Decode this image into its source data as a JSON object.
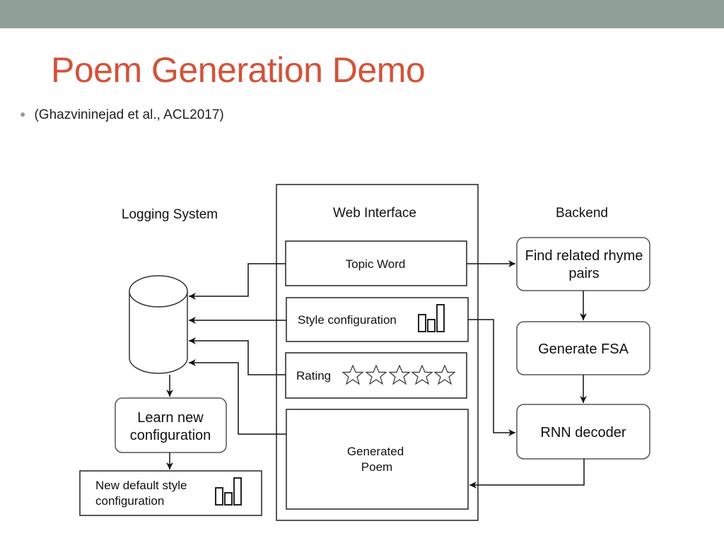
{
  "slide": {
    "title": "Poem Generation Demo",
    "bullet": "(Ghazvininejad et al., ACL2017)"
  },
  "diagram": {
    "headers": {
      "logging": "Logging System",
      "web": "Web Interface",
      "backend": "Backend"
    },
    "web": {
      "topic": "Topic Word",
      "style": "Style configuration",
      "rating": "Rating",
      "poem_line1": "Generated",
      "poem_line2": "Poem",
      "rating_stars_filled": 0,
      "rating_stars_total": 5
    },
    "backend": {
      "rhyme_line1": "Find related rhyme",
      "rhyme_line2": "pairs",
      "fsa": "Generate FSA",
      "rnn": "RNN decoder"
    },
    "logging": {
      "learn_line1": "Learn new",
      "learn_line2": "configuration",
      "default_line1": "New default style",
      "default_line2": "configuration"
    }
  }
}
